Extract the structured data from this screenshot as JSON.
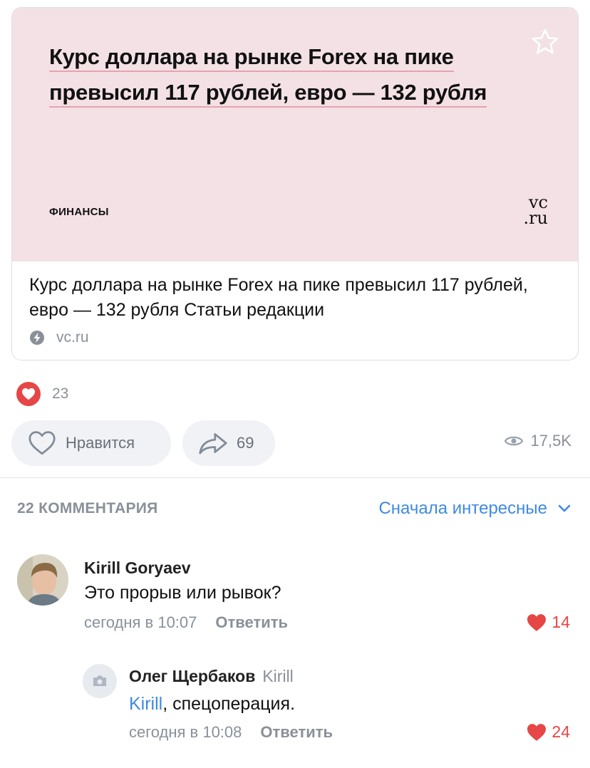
{
  "link_card": {
    "preview_title": "Курс доллара на рынке Forex на пике превысил 117 рублей, евро — 132 рубля",
    "preview_category": "ФИНАНСЫ",
    "logo_line1": "vc",
    "logo_line2": ".ru",
    "link_title": "Курс доллара на рынке Forex на пике превысил 117 рублей, евро — 132 рубля Статьи редакции",
    "source": "vc.ru",
    "bookmark_icon": "star-icon",
    "source_icon": "lightning-icon"
  },
  "reactions": {
    "count": "23",
    "icon": "heart-icon",
    "color": "#e64646"
  },
  "actions": {
    "like_label": "Нравится",
    "share_count": "69",
    "views": "17,5K"
  },
  "comments": {
    "count_label": "22 КОММЕНТАРИЯ",
    "sort_label": "Сначала интересные",
    "accent": "#3f8ae0",
    "items": [
      {
        "author": "Kirill Goryaev",
        "text": "Это прорыв или рывок?",
        "time": "сегодня в 10:07",
        "reply_label": "Ответить",
        "likes": "14"
      },
      {
        "author": "Олег Щербаков",
        "reply_to": "Kirill",
        "mention": "Kirill",
        "text": ", спецоперация.",
        "time": "сегодня в 10:08",
        "reply_label": "Ответить",
        "likes": "24"
      }
    ]
  }
}
